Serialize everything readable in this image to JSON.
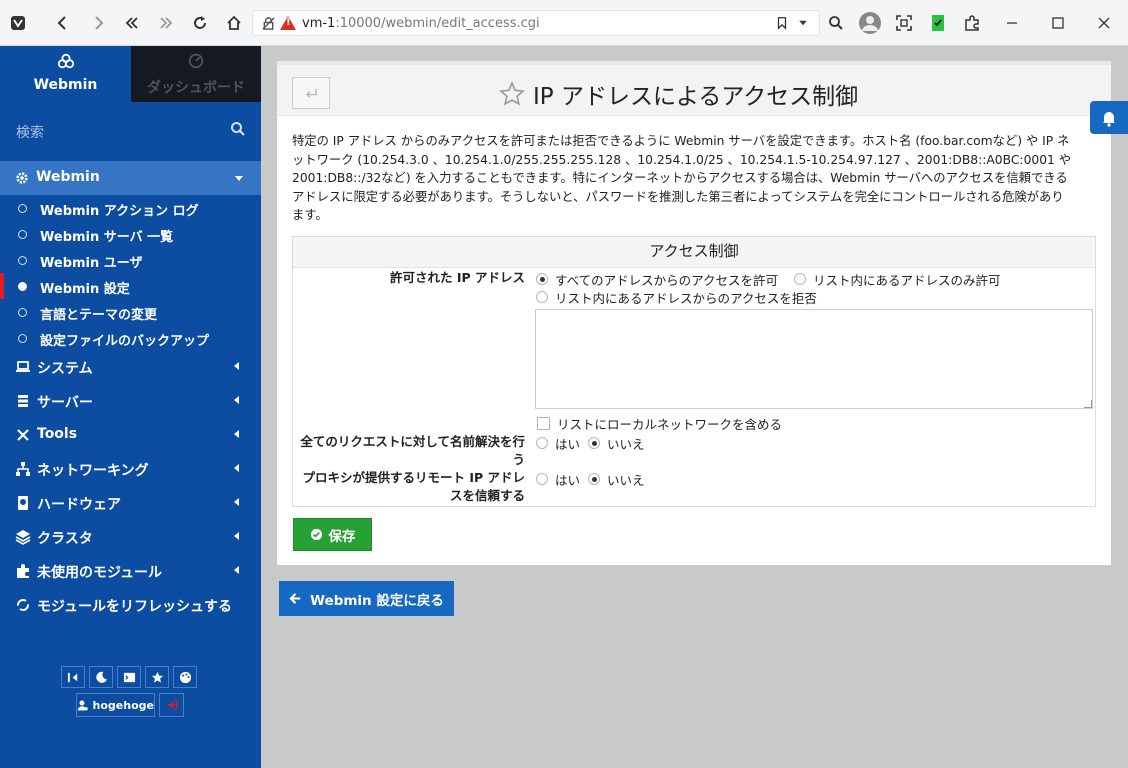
{
  "browser": {
    "url_host": "vm-1",
    "url_rest": ":10000/webmin/edit_access.cgi"
  },
  "sidebar": {
    "tab_webmin": "Webmin",
    "tab_dashboard": "ダッシュボード",
    "search_placeholder": "検索",
    "section_title": "Webmin",
    "items": [
      {
        "label": "Webmin アクション ログ",
        "active": false
      },
      {
        "label": "Webmin サーバ 一覧",
        "active": false
      },
      {
        "label": "Webmin ユーザ",
        "active": false
      },
      {
        "label": "Webmin 設定",
        "active": true
      },
      {
        "label": "言語とテーマの変更",
        "active": false
      },
      {
        "label": "設定ファイルのバックアップ",
        "active": false
      }
    ],
    "categories": [
      {
        "label": "システム",
        "icon": "laptop-icon"
      },
      {
        "label": "サーバー",
        "icon": "server-icon"
      },
      {
        "label": "Tools",
        "icon": "tools-icon"
      },
      {
        "label": "ネットワーキング",
        "icon": "network-icon"
      },
      {
        "label": "ハードウェア",
        "icon": "hardware-icon"
      },
      {
        "label": "クラスタ",
        "icon": "layers-icon"
      },
      {
        "label": "未使用のモジュール",
        "icon": "puzzle-icon"
      }
    ],
    "refresh_label": "モジュールをリフレッシュする",
    "username": "hogehoge"
  },
  "page": {
    "title": "IP アドレスによるアクセス制御",
    "intro_lines": [
      "特定の IP アドレス からのみアクセスを許可または拒否できるように Webmin サーバを設定できます。ホスト名 (foo.bar.comなど) や IP ネ",
      "ットワーク (10.254.3.0 、10.254.1.0/255.255.255.128 、10.254.1.0/25 、10.254.1.5-10.254.97.127 、2001:DB8::A0BC:0001 や",
      "2001:DB8::/32など) を入力することもできます。特にインターネットからアクセスする場合は、Webmin サーバへのアクセスを信頼できる",
      "アドレスに限定する必要があります。そうしないと、パスワードを推測した第三者によってシステムを完全にコントロールされる危険があり",
      "ます。"
    ],
    "form_title": "アクセス制御",
    "allowed_label": "許可された IP アドレス",
    "opt_all": "すべてのアドレスからのアクセスを許可",
    "opt_allow_list": "リスト内にあるアドレスのみ許可",
    "opt_deny_list": "リスト内にあるアドレスからのアクセスを拒否",
    "addresses_value": "",
    "include_local": "リストにローカルネットワークを含める",
    "resolve_label_1": "全てのリクエストに対して名前解決を行",
    "resolve_label_2": "う",
    "proxy_label_1": "プロキシが提供するリモート IP アドレ",
    "proxy_label_2": "スを信頼する",
    "yes": "はい",
    "no": "いいえ",
    "save": "保存",
    "return": "Webmin 設定に戻る"
  },
  "colors": {
    "sidebar_bg": "#0c4da2",
    "section_bg": "#3575c4",
    "save_green": "#27a034",
    "return_blue": "#1669c1",
    "active_marker": "#e31b23"
  }
}
